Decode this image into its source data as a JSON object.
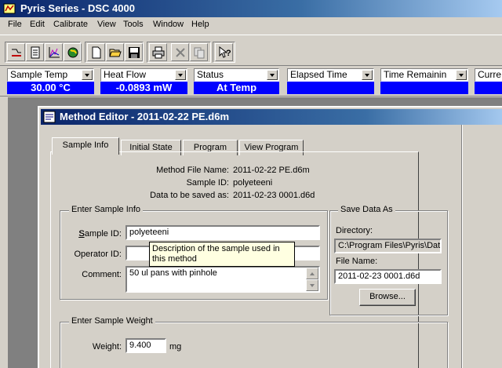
{
  "app": {
    "title": "Pyris Series - DSC 4000"
  },
  "menu": [
    "File",
    "Edit",
    "Calibrate",
    "View",
    "Tools",
    "Window",
    "Help"
  ],
  "toolbar": {
    "icons": [
      "method-icon",
      "document-icon",
      "graph-icon",
      "globe-icon",
      "new-file-icon",
      "open-folder-icon",
      "save-icon",
      "print-icon",
      "cancel-icon",
      "copy-icon",
      "help-pointer-icon"
    ]
  },
  "status": [
    {
      "label": "Sample Temp",
      "value": "30.00 °C"
    },
    {
      "label": "Heat Flow",
      "value": "-0.0893 mW"
    },
    {
      "label": "Status",
      "value": "At Temp"
    },
    {
      "label": "Elapsed Time",
      "value": ""
    },
    {
      "label": "Time Remainin",
      "value": ""
    },
    {
      "label": "Curre",
      "value": ""
    }
  ],
  "method_editor": {
    "title": "Method Editor - 2011-02-22 PE.d6m",
    "tabs": [
      "Sample Info",
      "Initial State",
      "Program",
      "View Program"
    ],
    "active_tab": "Sample Info",
    "info": {
      "file_name_label": "Method File Name:",
      "file_name": "2011-02-22 PE.d6m",
      "sample_id_label": "Sample ID:",
      "sample_id": "polyeteeni",
      "data_label": "Data to be saved as:",
      "data": "2011-02-23 0001.d6d"
    },
    "sample_info": {
      "group_title": "Enter Sample Info",
      "sample_id_label": "Sample ID:",
      "sample_id_value": "polyeteeni",
      "operator_label": "Operator ID:",
      "operator_value": "",
      "comment_label": "Comment:",
      "comment_value": "50 ul pans with pinhole",
      "tooltip": "Description of the sample used in this method"
    },
    "save_data": {
      "group_title": "Save Data As",
      "directory_label": "Directory:",
      "directory_value": "C:\\Program Files\\Pyris\\Dat",
      "file_name_label": "File Name:",
      "file_name_value": "2011-02-23 0001.d6d",
      "browse_label": "Browse..."
    },
    "sample_weight": {
      "group_title": "Enter Sample Weight",
      "weight_label": "Weight:",
      "weight_value": "9.400",
      "unit": "mg"
    }
  },
  "colors": {
    "title_bar": "#0a246a",
    "status_value_bg": "#0000ff",
    "tooltip_bg": "#ffffe1"
  }
}
